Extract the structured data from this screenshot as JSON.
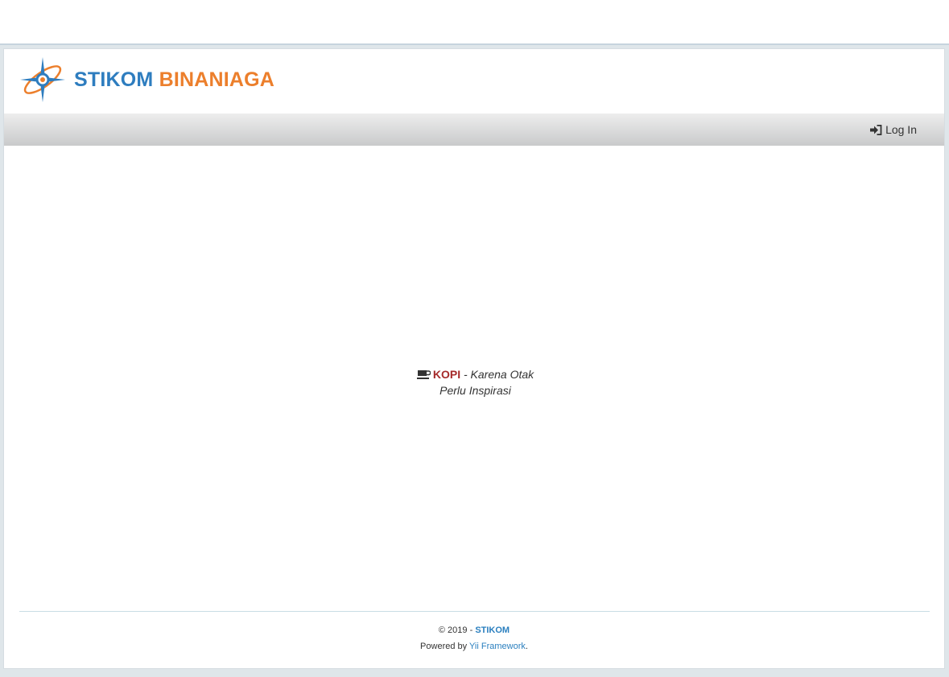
{
  "header": {
    "brand_part1": "STIKOM",
    "brand_part2": "BINANIAGA",
    "logo_icon": "compass-atom-logo"
  },
  "navbar": {
    "login_label": "Log In",
    "login_icon": "sign-in-icon"
  },
  "main": {
    "quote_highlight": "KOPI",
    "quote_text": "- Karena Otak Perlu Inspirasi",
    "quote_icon": "coffee-cup-icon"
  },
  "footer": {
    "copyright_prefix": "© 2019 -",
    "copyright_org": "STIKOM",
    "powered_prefix": "Powered by",
    "powered_link": "Yii Framework",
    "powered_suffix": "."
  },
  "colors": {
    "brand_blue": "#2e7dbf",
    "brand_orange": "#ec7f2c",
    "kopi_red": "#a52a2a",
    "link_blue": "#2a7fbf"
  }
}
